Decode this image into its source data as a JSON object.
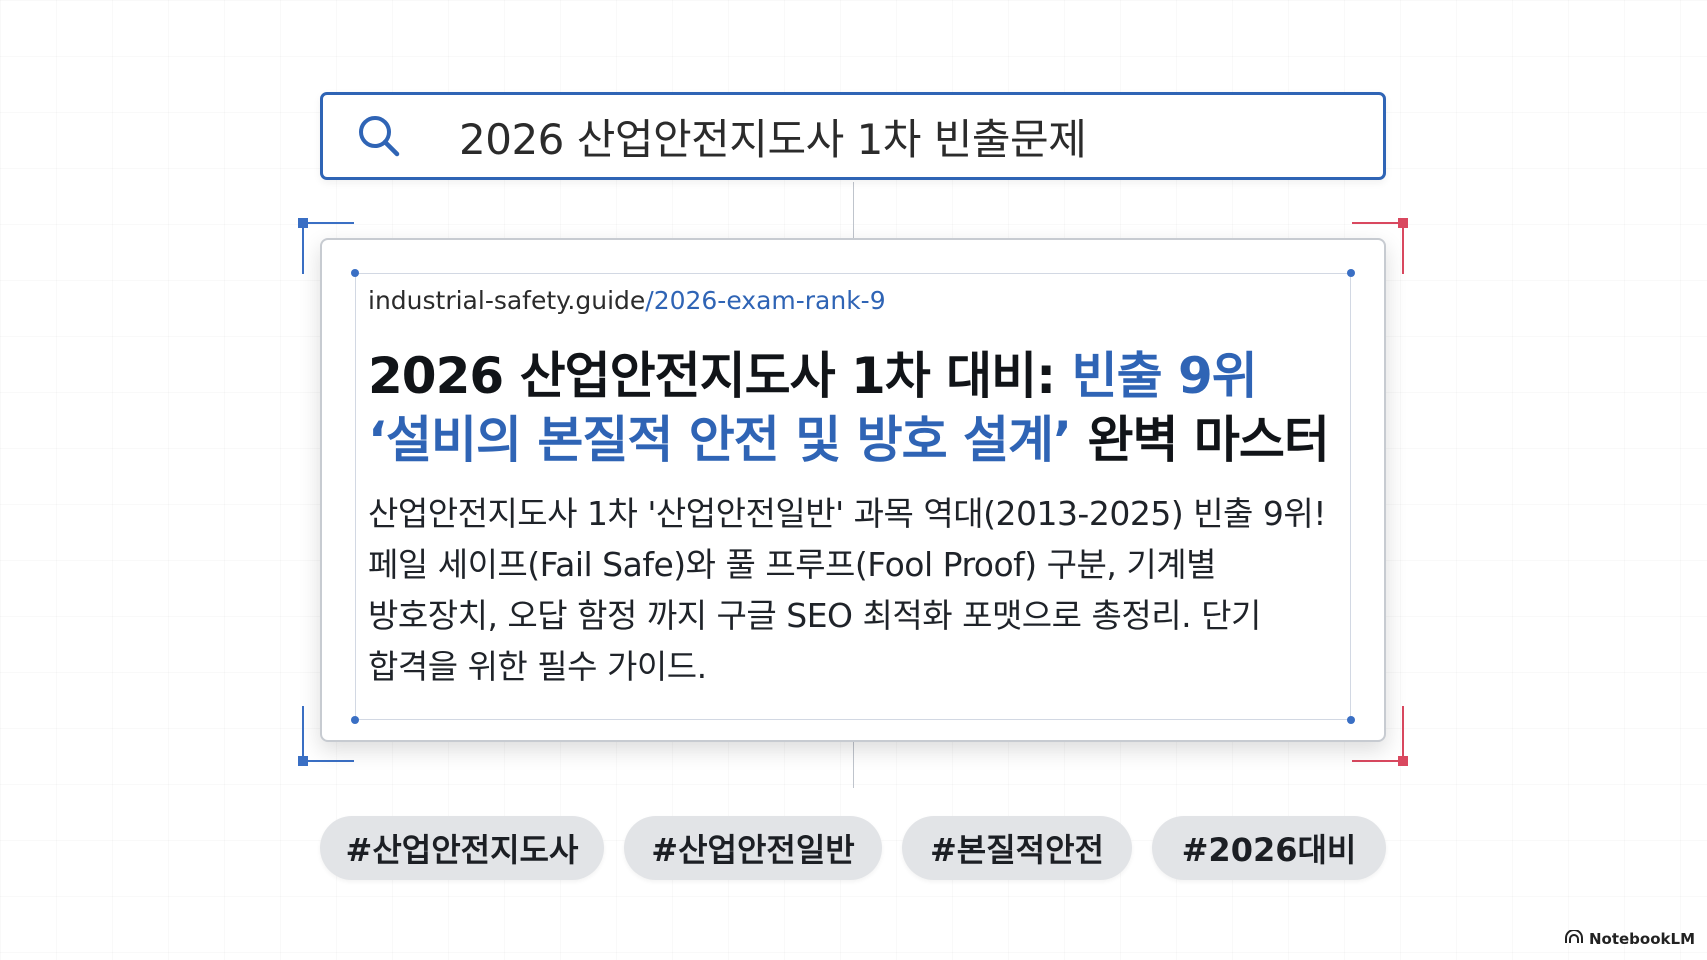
{
  "search": {
    "query": "2026 산업안전지도사 1차 빈출문제",
    "icon": "search-icon"
  },
  "result": {
    "url_domain": "industrial-safety.guide",
    "url_path": "/2026-exam-rank-9",
    "title_line1_plain": "2026 산업안전지도사 1차 대비: ",
    "title_line1_highlight": "빈출 9위",
    "title_line2_highlight": "‘설비의 본질적 안전 및 방호 설계’",
    "title_line2_plain": " 완벽 마스터",
    "snippet_lines": [
      "산업안전지도사 1차 '산업안전일반' 과목 역대(2013-2025) 빈출 9위!",
      "페일 세이프(Fail Safe)와 풀 프루프(Fool Proof) 구분, 기계별",
      "방호장치, 오답 함정 까지 구글 SEO 최적화 포맷으로 총정리. 단기",
      "합격을 위한 필수 가이드."
    ]
  },
  "tags": [
    "#산업안전지도사",
    "#산업안전일반",
    "#본질적안전",
    "#2026대비"
  ],
  "watermark": {
    "label": "NotebookLM",
    "icon": "notebooklm-logo-icon"
  },
  "colors": {
    "accent_blue": "#2f64b5",
    "bracket_red": "#d9485f",
    "chip_bg": "#e2e4e7"
  }
}
